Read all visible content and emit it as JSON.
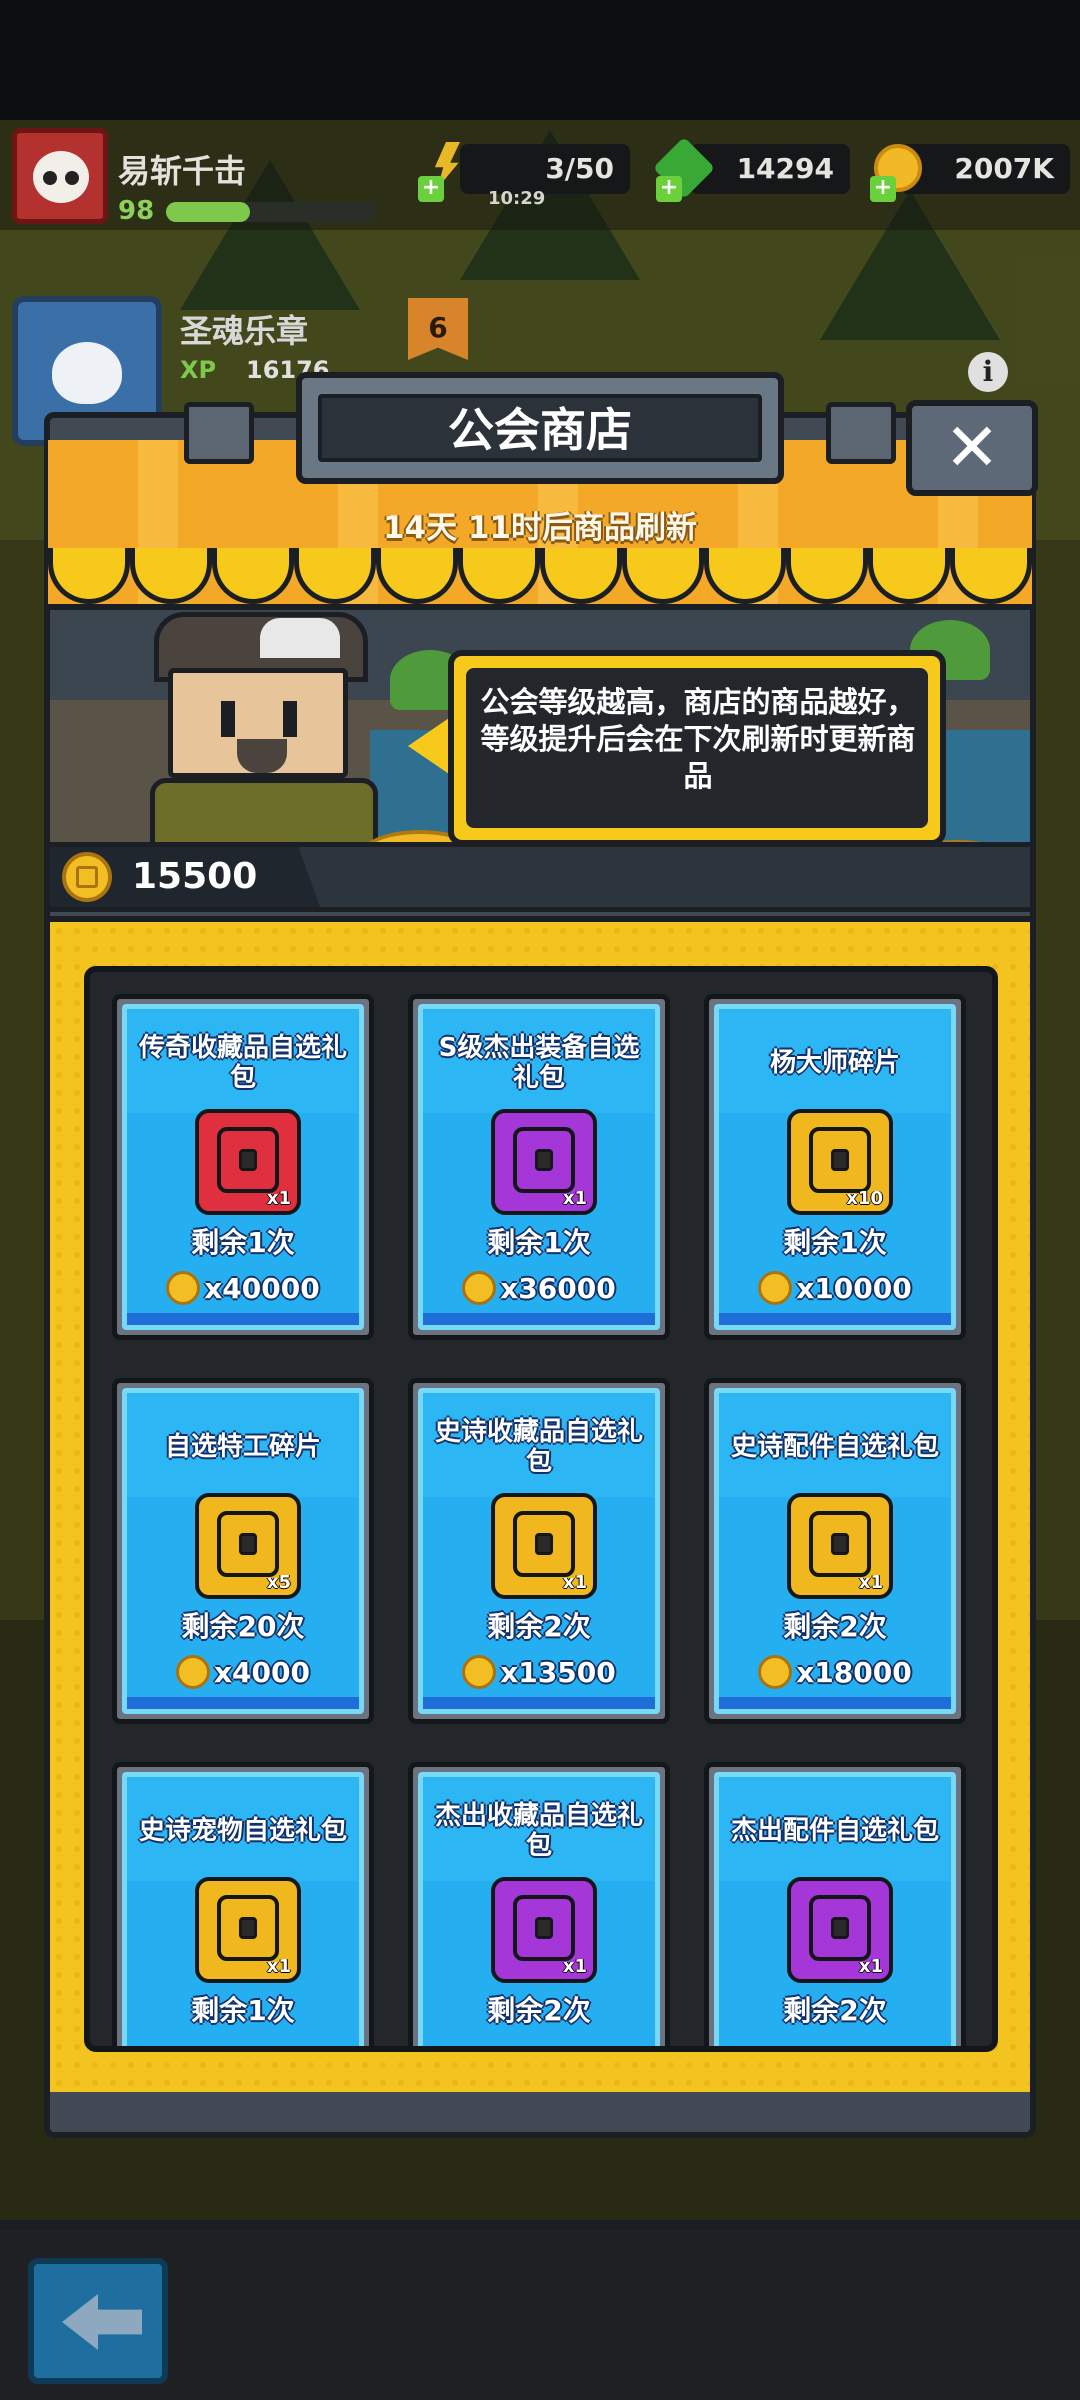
{
  "hud": {
    "player_name": "易斩千击",
    "player_level": "98",
    "xp_fraction": 0.4,
    "energy": "3/50",
    "energy_timer": "10:29",
    "gems": "14294",
    "coins": "2007K"
  },
  "guild": {
    "name": "圣魂乐章",
    "xp_label": "XP",
    "xp_value": "16176",
    "level": "6"
  },
  "shop": {
    "title": "公会商店",
    "refresh_text": "14天 11时后商品刷新",
    "keeper_speech": "公会等级越高，商店的商品越好，等级提升后会在下次刷新时更新商品",
    "guild_coins": "15500",
    "items": [
      {
        "title": "传奇收藏品自选礼包",
        "qty": "x1",
        "remaining": "剩余1次",
        "price": "x40000",
        "color": "#e0303f"
      },
      {
        "title": "S级杰出装备自选礼包",
        "qty": "x1",
        "remaining": "剩余1次",
        "price": "x36000",
        "color": "#a536d8"
      },
      {
        "title": "杨大师碎片",
        "qty": "x10",
        "remaining": "剩余1次",
        "price": "x10000",
        "color": "#f0b81e"
      },
      {
        "title": "自选特工碎片",
        "qty": "x5",
        "remaining": "剩余20次",
        "price": "x4000",
        "color": "#f0b81e"
      },
      {
        "title": "史诗收藏品自选礼包",
        "qty": "x1",
        "remaining": "剩余2次",
        "price": "x13500",
        "color": "#f0b81e"
      },
      {
        "title": "史诗配件自选礼包",
        "qty": "x1",
        "remaining": "剩余2次",
        "price": "x18000",
        "color": "#f0b81e"
      },
      {
        "title": "史诗宠物自选礼包",
        "qty": "x1",
        "remaining": "剩余1次",
        "price": "",
        "color": "#f0b81e"
      },
      {
        "title": "杰出收藏品自选礼包",
        "qty": "x1",
        "remaining": "剩余2次",
        "price": "",
        "color": "#a536d8"
      },
      {
        "title": "杰出配件自选礼包",
        "qty": "x1",
        "remaining": "剩余2次",
        "price": "",
        "color": "#a536d8"
      }
    ]
  },
  "icons": {
    "close": "close-icon",
    "back": "back-arrow-icon",
    "info": "info-icon"
  }
}
